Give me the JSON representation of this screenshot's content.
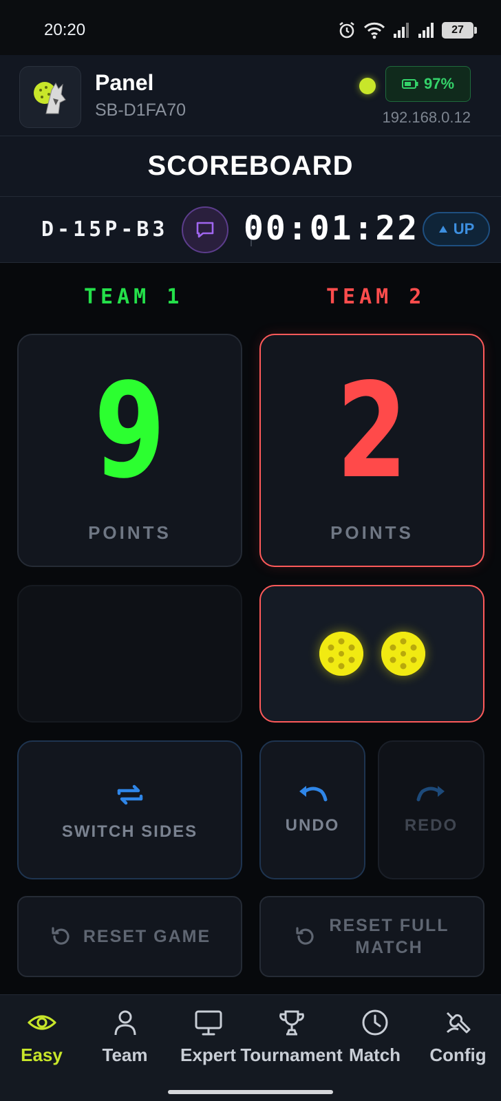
{
  "status_bar": {
    "time": "20:20",
    "battery": "27"
  },
  "header": {
    "title": "Panel",
    "device_id": "SB-D1FA70",
    "battery_percent": "97%",
    "ip": "192.168.0.12",
    "connection_color": "#c8e62a"
  },
  "page_title": "SCOREBOARD",
  "match": {
    "code": "D-15P-B3",
    "timer": "00:01:22",
    "timer_mode": "UP"
  },
  "teams": [
    {
      "name": "TEAM 1",
      "score": "9",
      "points_label": "POINTS",
      "color": "#2cff30",
      "serving": false
    },
    {
      "name": "TEAM 2",
      "score": "2",
      "points_label": "POINTS",
      "color": "#ff4a4a",
      "serving": true,
      "serve_count": 2
    }
  ],
  "actions": {
    "switch_sides": "SWITCH SIDES",
    "undo": "UNDO",
    "redo": "REDO",
    "reset_game": "RESET GAME",
    "reset_full_match": "RESET FULL MATCH"
  },
  "nav": [
    {
      "label": "Easy",
      "icon": "eye-icon",
      "active": true
    },
    {
      "label": "Team",
      "icon": "user-icon",
      "active": false
    },
    {
      "label": "Expert",
      "icon": "monitor-icon",
      "active": false
    },
    {
      "label": "Tournament",
      "icon": "trophy-icon",
      "active": false
    },
    {
      "label": "Match",
      "icon": "clock-icon",
      "active": false
    },
    {
      "label": "Config",
      "icon": "config-icon",
      "active": false
    }
  ],
  "colors": {
    "accent": "#c8e62a",
    "team1": "#2cff30",
    "team2": "#ff4a4a",
    "ball": "#f1ea12"
  }
}
